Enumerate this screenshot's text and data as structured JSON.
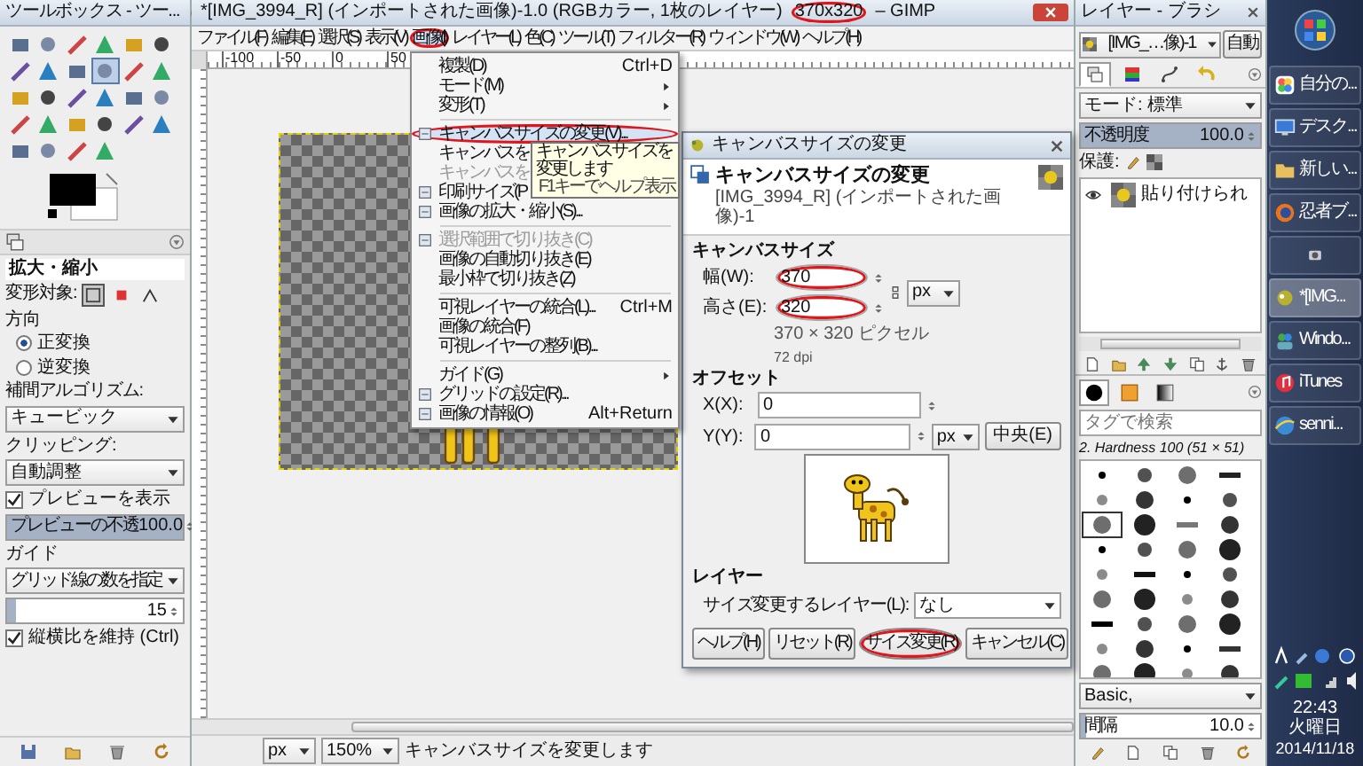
{
  "toolbox": {
    "title": "ツールボックス - ツー...",
    "options": {
      "title": "拡大・縮小",
      "target_label": "変形対象:",
      "targets": [
        {
          "kind": "layer",
          "selected": true
        },
        {
          "kind": "selection",
          "selected": false
        },
        {
          "kind": "path",
          "selected": false
        }
      ],
      "direction_label": "方向",
      "directions": [
        {
          "label": "正変換",
          "selected": true
        },
        {
          "label": "逆変換",
          "selected": false
        }
      ],
      "interpolation_label": "補間アルゴリズム:",
      "interpolation": "キュービック",
      "clipping_label": "クリッピング:",
      "clipping": "自動調整",
      "preview": {
        "label": "プレビューを表示",
        "checked": true
      },
      "preview_opacity": {
        "label": "プレビューの不透",
        "value": "100.0",
        "level": 1
      },
      "guides_label": "ガイド",
      "guides": "グリッド線の数を指定",
      "grid_lines": {
        "value": "15",
        "level": 0.05
      },
      "keep_aspect": {
        "label": "縦横比を維持 (Ctrl)",
        "checked": true
      }
    }
  },
  "image_window": {
    "title_parts": [
      {
        "text": "*[IMG_3994_R] (インポートされた画像)-1.0 (RGBカラー, 1枚のレイヤー)",
        "circled": false
      },
      {
        "text": "370x320",
        "circled": true
      },
      {
        "text": "– GIMP",
        "circled": false
      }
    ],
    "menus": [
      {
        "label": "ファイル(F)",
        "selected": false,
        "circled": false
      },
      {
        "label": "編集(E)",
        "selected": false,
        "circled": false
      },
      {
        "label": "選択(S)",
        "selected": false,
        "circled": false
      },
      {
        "label": "表示(V)",
        "selected": false,
        "circled": false
      },
      {
        "label": "画像(I)",
        "selected": true,
        "circled": true
      },
      {
        "label": "レイヤー(L)",
        "selected": false,
        "circled": false
      },
      {
        "label": "色(C)",
        "selected": false,
        "circled": false
      },
      {
        "label": "ツール(T)",
        "selected": false,
        "circled": false
      },
      {
        "label": "フィルター(R)",
        "selected": false,
        "circled": false
      },
      {
        "label": "ウィンドウ(W)",
        "selected": false,
        "circled": false
      },
      {
        "label": "ヘルプ(H)",
        "selected": false,
        "circled": false
      }
    ],
    "ruler_labels": [
      "-100",
      "-50",
      "0",
      "50"
    ],
    "image_menu": [
      {
        "kind": "item",
        "label": "複製(D)",
        "shortcut": "Ctrl+D",
        "icon": false,
        "submenu": false,
        "selected": false,
        "disabled": false,
        "circled": false
      },
      {
        "kind": "item",
        "label": "モード(M)",
        "icon": false,
        "submenu": true,
        "selected": false,
        "disabled": false,
        "circled": false
      },
      {
        "kind": "item",
        "label": "変形(T)",
        "icon": false,
        "submenu": true,
        "selected": false,
        "disabled": false,
        "circled": false
      },
      {
        "kind": "separator"
      },
      {
        "kind": "item",
        "label": "キャンバスサイズの変更(V)...",
        "icon": true,
        "submenu": false,
        "selected": true,
        "disabled": false,
        "circled": true
      },
      {
        "kind": "item",
        "label": "キャンバスを",
        "icon": false,
        "selected": false,
        "disabled": false,
        "circled": false
      },
      {
        "kind": "item",
        "label": "キャンバスを",
        "icon": false,
        "selected": false,
        "disabled": true,
        "circled": false
      },
      {
        "kind": "item",
        "label": "印刷サイズ(P",
        "icon": true,
        "submenu": false,
        "selected": false,
        "disabled": false,
        "circled": false
      },
      {
        "kind": "item",
        "label": "画像の拡大・縮小(S)...",
        "icon": true,
        "submenu": false,
        "selected": false,
        "disabled": false,
        "circled": false
      },
      {
        "kind": "separator"
      },
      {
        "kind": "item",
        "label": "選択範囲で切り抜き(C)",
        "icon": true,
        "submenu": false,
        "selected": false,
        "disabled": true,
        "circled": false
      },
      {
        "kind": "item",
        "label": "画像の自動切り抜き(E)",
        "icon": false,
        "submenu": false,
        "selected": false,
        "disabled": false,
        "circled": false
      },
      {
        "kind": "item",
        "label": "最小枠で切り抜き(Z)",
        "icon": false,
        "submenu": false,
        "selected": false,
        "disabled": false,
        "circled": false
      },
      {
        "kind": "separator"
      },
      {
        "kind": "item",
        "label": "可視レイヤーの統合(L)...",
        "shortcut": "Ctrl+M",
        "icon": false,
        "submenu": false,
        "selected": false,
        "disabled": false,
        "circled": false
      },
      {
        "kind": "item",
        "label": "画像の統合(F)",
        "icon": false,
        "submenu": false,
        "selected": false,
        "disabled": false,
        "circled": false
      },
      {
        "kind": "item",
        "label": "可視レイヤーの整列(B)...",
        "icon": false,
        "submenu": false,
        "selected": false,
        "disabled": false,
        "circled": false
      },
      {
        "kind": "separator"
      },
      {
        "kind": "item",
        "label": "ガイド(G)",
        "icon": false,
        "submenu": true,
        "selected": false,
        "disabled": false,
        "circled": false
      },
      {
        "kind": "item",
        "label": "グリッドの設定(R)...",
        "icon": true,
        "submenu": false,
        "selected": false,
        "disabled": false,
        "circled": false
      },
      {
        "kind": "item",
        "label": "画像の情報(O)",
        "shortcut": "Alt+Return",
        "icon": true,
        "submenu": false,
        "selected": false,
        "disabled": false,
        "circled": false
      }
    ],
    "tooltip": {
      "text": "キャンバスサイズを変更します",
      "hint": "F1キーでヘルプ表示"
    },
    "status_bar": {
      "unit": "px",
      "zoom": "150%",
      "message": "キャンバスサイズを変更します"
    }
  },
  "canvas_dialog": {
    "title": "キャンバスサイズの変更",
    "heading": "キャンバスサイズの変更",
    "subtitle": "[IMG_3994_R] (インポートされた画像)-1",
    "size_section": "キャンバスサイズ",
    "width": {
      "label": "幅(W):",
      "value": "370",
      "circled": true
    },
    "height": {
      "label": "高さ(E):",
      "value": "320",
      "circled": true
    },
    "size_unit": "px",
    "size_info": "370 × 320 ピクセル",
    "resolution": "72 dpi",
    "offset_section": "オフセット",
    "offset_x": {
      "label": "X(X):",
      "value": "0"
    },
    "offset_y": {
      "label": "Y(Y):",
      "value": "0"
    },
    "offset_unit": "px",
    "center_button": "中央(E)",
    "layers_section": "レイヤー",
    "resize_layers_label": "サイズ変更するレイヤー(L):",
    "resize_layers": "なし",
    "buttons": [
      {
        "label": "ヘルプ(H)",
        "circled": false
      },
      {
        "label": "リセット(R)",
        "circled": false
      },
      {
        "label": "サイズ変更(R)",
        "circled": true
      },
      {
        "label": "キャンセル(C)",
        "circled": false
      }
    ]
  },
  "dock": {
    "title": "レイヤー - ブラシ",
    "image": "[IMG_…像)-1",
    "auto_button": "自動",
    "tabs": [
      {
        "kind": "layers",
        "selected": true
      },
      {
        "kind": "channels",
        "selected": false
      },
      {
        "kind": "paths",
        "selected": false
      },
      {
        "kind": "undo",
        "selected": false
      }
    ],
    "mode": "モード: 標準",
    "opacity": {
      "label": "不透明度",
      "value": "100.0",
      "level": 1
    },
    "lock_label": "保護:",
    "layers": [
      {
        "name": "貼り付けられ",
        "visible": true
      }
    ],
    "brush_tabs": [
      {
        "kind": "brushes",
        "selected": true
      },
      {
        "kind": "patterns",
        "selected": false
      },
      {
        "kind": "gradients",
        "selected": false
      }
    ],
    "tag_filter": {
      "placeholder": "タグで検索"
    },
    "brush_name": "2. Hardness 100 (51 × 51)",
    "brush_set": "Basic,",
    "spacing": {
      "label": "間隔",
      "value": "10.0",
      "level": 0.03
    }
  },
  "taskbar": {
    "items": [
      {
        "kind": "photos",
        "label": "自分の...",
        "selected": false
      },
      {
        "kind": "monitor",
        "label": "デスク...",
        "selected": false
      },
      {
        "kind": "folder",
        "label": "新しい...",
        "selected": false
      },
      {
        "kind": "browser",
        "label": "忍者ブ...",
        "selected": false
      },
      {
        "kind": "device",
        "selected": false
      },
      {
        "kind": "paint",
        "label": "*[IMG...",
        "selected": true
      },
      {
        "kind": "people",
        "label": "Windo...",
        "selected": false
      },
      {
        "kind": "music",
        "label": "iTunes",
        "selected": false
      },
      {
        "kind": "globe",
        "label": "senni...",
        "selected": false
      }
    ],
    "time": "22:43",
    "weekday": "火曜日",
    "date": "2014/11/18"
  }
}
